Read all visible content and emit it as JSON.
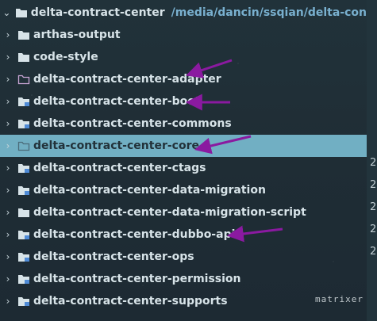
{
  "tree": {
    "root": {
      "name": "delta-contract-center",
      "path": "/media/dancin/ssqian/delta-contract-ce"
    },
    "items": [
      {
        "name": "arthas-output",
        "type": "plain",
        "expanded": false
      },
      {
        "name": "code-style",
        "type": "plain",
        "expanded": false
      },
      {
        "name": "delta-contract-center-adapter",
        "type": "outline",
        "expanded": false
      },
      {
        "name": "delta-contract-center-boot",
        "type": "module",
        "expanded": false
      },
      {
        "name": "delta-contract-center-commons",
        "type": "module",
        "expanded": false
      },
      {
        "name": "delta-contract-center-core",
        "type": "outline",
        "expanded": false,
        "selected": true
      },
      {
        "name": "delta-contract-center-ctags",
        "type": "module",
        "expanded": false
      },
      {
        "name": "delta-contract-center-data-migration",
        "type": "module",
        "expanded": false
      },
      {
        "name": "delta-contract-center-data-migration-script",
        "type": "plain",
        "expanded": false
      },
      {
        "name": "delta-contract-center-dubbo-api",
        "type": "module",
        "expanded": false
      },
      {
        "name": "delta-contract-center-ops",
        "type": "module",
        "expanded": false
      },
      {
        "name": "delta-contract-center-permission",
        "type": "module",
        "expanded": false
      },
      {
        "name": "delta-contract-center-supports",
        "type": "module",
        "expanded": false
      }
    ]
  },
  "right_strip": {
    "digits": [
      "2",
      "2",
      "2",
      "2",
      "2"
    ]
  },
  "watermark": "matrixer",
  "colors": {
    "arrow": "#8a1aa0",
    "selected": "#71afc3",
    "path": "#79b0cf",
    "folder": "#d7e3e8",
    "module_badge": "#4f8bd6"
  }
}
